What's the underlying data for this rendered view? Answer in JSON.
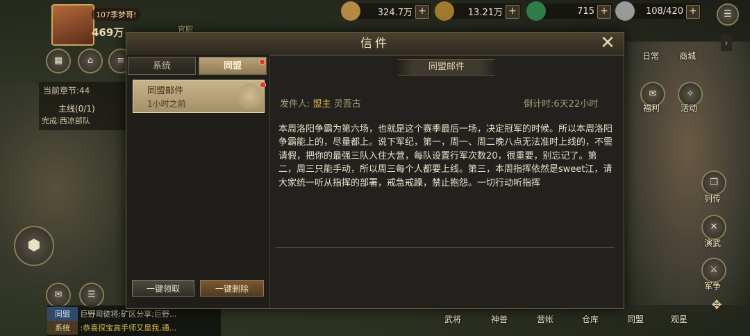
{
  "player": {
    "level_name": "107季梦哥!",
    "power": "469万",
    "badge": "官职"
  },
  "resources": [
    {
      "name": "grain",
      "value": "324.7万",
      "color": "#c9a15a"
    },
    {
      "name": "copper",
      "value": "13.21万",
      "color": "#b98c3a"
    },
    {
      "name": "jade",
      "value": "715",
      "color": "#3f9a5e"
    },
    {
      "name": "troops",
      "value": "108/420",
      "color": "#cfcfcf"
    }
  ],
  "top_right_icons": {
    "daily": "日常",
    "shop": "商城"
  },
  "right_menu": {
    "welfare": "福利",
    "event": "活动",
    "biography": "列传",
    "drill": "演武",
    "war": "军争"
  },
  "bottom_menu": [
    "武将",
    "神兽",
    "营帐",
    "仓库",
    "同盟",
    "观星"
  ],
  "quest": {
    "chapter": "当前章节:",
    "chapter_num": "44",
    "main": "主线(0/1)",
    "done": "完成:西凉部队"
  },
  "chat": [
    {
      "tag": "同盟",
      "text": "巨野司徒将:矿区分享;巨野..."
    },
    {
      "tag": "系统",
      "text": ":恭喜探宝高手师又是我,通..."
    }
  ],
  "dialog": {
    "title": "信件",
    "tabs": [
      {
        "label": "系统"
      },
      {
        "label": "同盟"
      }
    ],
    "mail_item": {
      "title": "同盟邮件",
      "time": "1小时之前"
    },
    "sub_header": "同盟邮件",
    "sender_label": "发件人:",
    "sender_role": "盟主",
    "sender_name": "灵吾古",
    "countdown": "倒计时:6天22小时",
    "body": "本周洛阳争霸为第六场，也就是这个赛季最后一场，决定冠军的时候。所以本周洛阳争霸能上的，尽量都上。说下军纪，第一，周一、周二晚八点无法准时上线的，不需请假，把你的最强三队入住大营，每队设置行军次数20，很重要，别忘记了。第二，周三只能手动，所以周三每个人都要上线。第三，本周指挥依然是sweet江，请大家统一听从指挥的部署，戒急戒躁，禁止抱怨。一切行动听指挥",
    "claim_all": "一键领取",
    "delete_all": "一键删除"
  }
}
